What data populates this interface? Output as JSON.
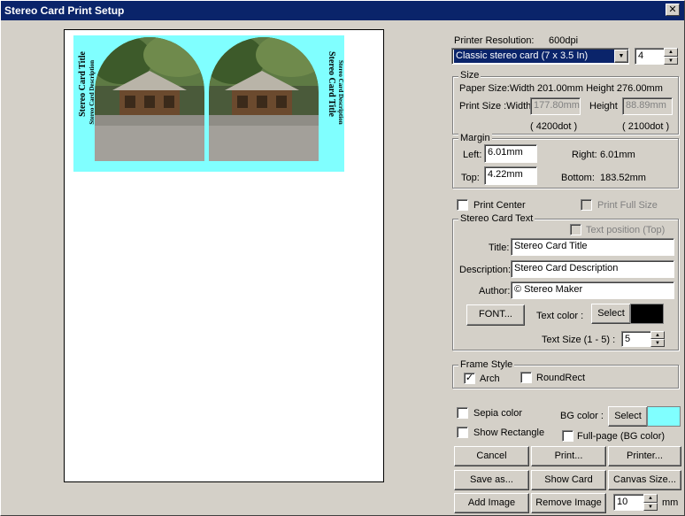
{
  "window": {
    "title": "Stereo Card Print Setup",
    "close_glyph": "✕"
  },
  "preview": {
    "card_title": "Stereo Card Title",
    "card_description": "Stereo Card Description",
    "bg_color": "#80ffff"
  },
  "printer": {
    "resolution_label": "Printer Resolution:",
    "resolution_value": "600dpi",
    "card_type": "Classic stereo card (7 x 3.5 In)",
    "count": "4"
  },
  "size": {
    "legend": "Size",
    "paper_size": "Paper Size:Width 201.00mm  Height 276.00mm",
    "print_size_label": "Print Size :Width",
    "width_value": "177.80mm",
    "height_label": "Height",
    "height_value": "88.89mm",
    "width_dots": "( 4200dot )",
    "height_dots": "( 2100dot )"
  },
  "margin": {
    "legend": "Margin",
    "left_label": "Left:",
    "left_value": "6.01mm",
    "right_label": "Right:",
    "right_value": "6.01mm",
    "top_label": "Top:",
    "top_value": "4.22mm",
    "bottom_label": "Bottom:",
    "bottom_value": "183.52mm"
  },
  "options": {
    "print_center": "Print Center",
    "print_full_size": "Print Full Size"
  },
  "text": {
    "legend": "Stereo Card Text",
    "text_position": "Text position (Top)",
    "title_label": "Title:",
    "title_value": "Stereo Card Title",
    "description_label": "Description:",
    "description_value": "Stereo Card Description",
    "author_label": "Author:",
    "author_value": "© Stereo Maker",
    "font_button": "FONT...",
    "text_color_label": "Text color :",
    "select_button": "Select",
    "text_color": "#000000",
    "text_size_label": "Text Size (1 - 5) :",
    "text_size_value": "5"
  },
  "frame": {
    "legend": "Frame Style",
    "arch": "Arch",
    "arch_checked": true,
    "roundrect": "RoundRect"
  },
  "extras": {
    "sepia": "Sepia color",
    "show_rectangle": "Show Rectangle",
    "bg_color_label": "BG color :",
    "bg_select": "Select",
    "bg_color": "#80ffff",
    "full_page": "Full-page (BG color)"
  },
  "buttons": {
    "cancel": "Cancel",
    "print": "Print...",
    "printer": "Printer...",
    "save_as": "Save as...",
    "show_card": "Show Card",
    "canvas_size": "Canvas Size...",
    "add_image": "Add Image",
    "remove_image": "Remove Image",
    "gap_value": "10",
    "gap_unit": "mm"
  }
}
